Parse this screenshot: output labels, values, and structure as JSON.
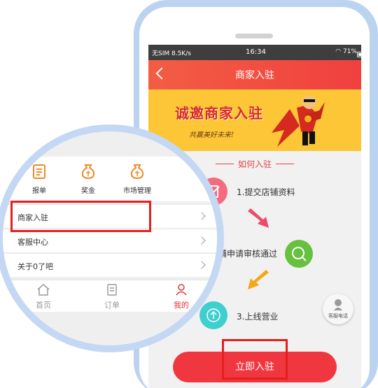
{
  "phone": {
    "status_bar": {
      "carrier": "无SIM 8.5K/s",
      "time": "16:34",
      "battery": "71%"
    },
    "header": {
      "back_icon": "chevron-left-icon",
      "title": "商家入驻"
    },
    "banner": {
      "title": "诚邀商家入驻",
      "slogan": "共赢美好未来!"
    },
    "howto": {
      "heading": "如何入驻",
      "steps": [
        {
          "label": "1.提交店铺资料",
          "icon": "edit-icon",
          "color": "#f26b7e"
        },
        {
          "label": "铺申请审核通过",
          "icon": "search-icon",
          "color": "#67c13e"
        },
        {
          "label": "3.上线营业",
          "icon": "upload-icon",
          "color": "#3fcfcf"
        }
      ]
    },
    "support_button": {
      "label": "客服电话",
      "icon": "headset-icon"
    },
    "cta": {
      "label": "立即入驻"
    }
  },
  "zoom": {
    "quick_actions": [
      {
        "label": "报单",
        "icon": "clipboard-icon"
      },
      {
        "label": "奖金",
        "icon": "money-bag-icon"
      },
      {
        "label": "市场管理",
        "icon": "money-bag-icon"
      }
    ],
    "menu": [
      {
        "label": "商家入驻"
      },
      {
        "label": "客服中心"
      },
      {
        "label": "关于0了吧"
      }
    ],
    "tabs": [
      {
        "label": "首页",
        "icon": "home-icon"
      },
      {
        "label": "订单",
        "icon": "orders-icon"
      },
      {
        "label": "我的",
        "icon": "user-icon"
      }
    ]
  },
  "colors": {
    "accent_red": "#f0373f",
    "highlight_red": "#e61e1e",
    "banner_yellow": "#fcc637",
    "icon_orange": "#f08a24"
  }
}
